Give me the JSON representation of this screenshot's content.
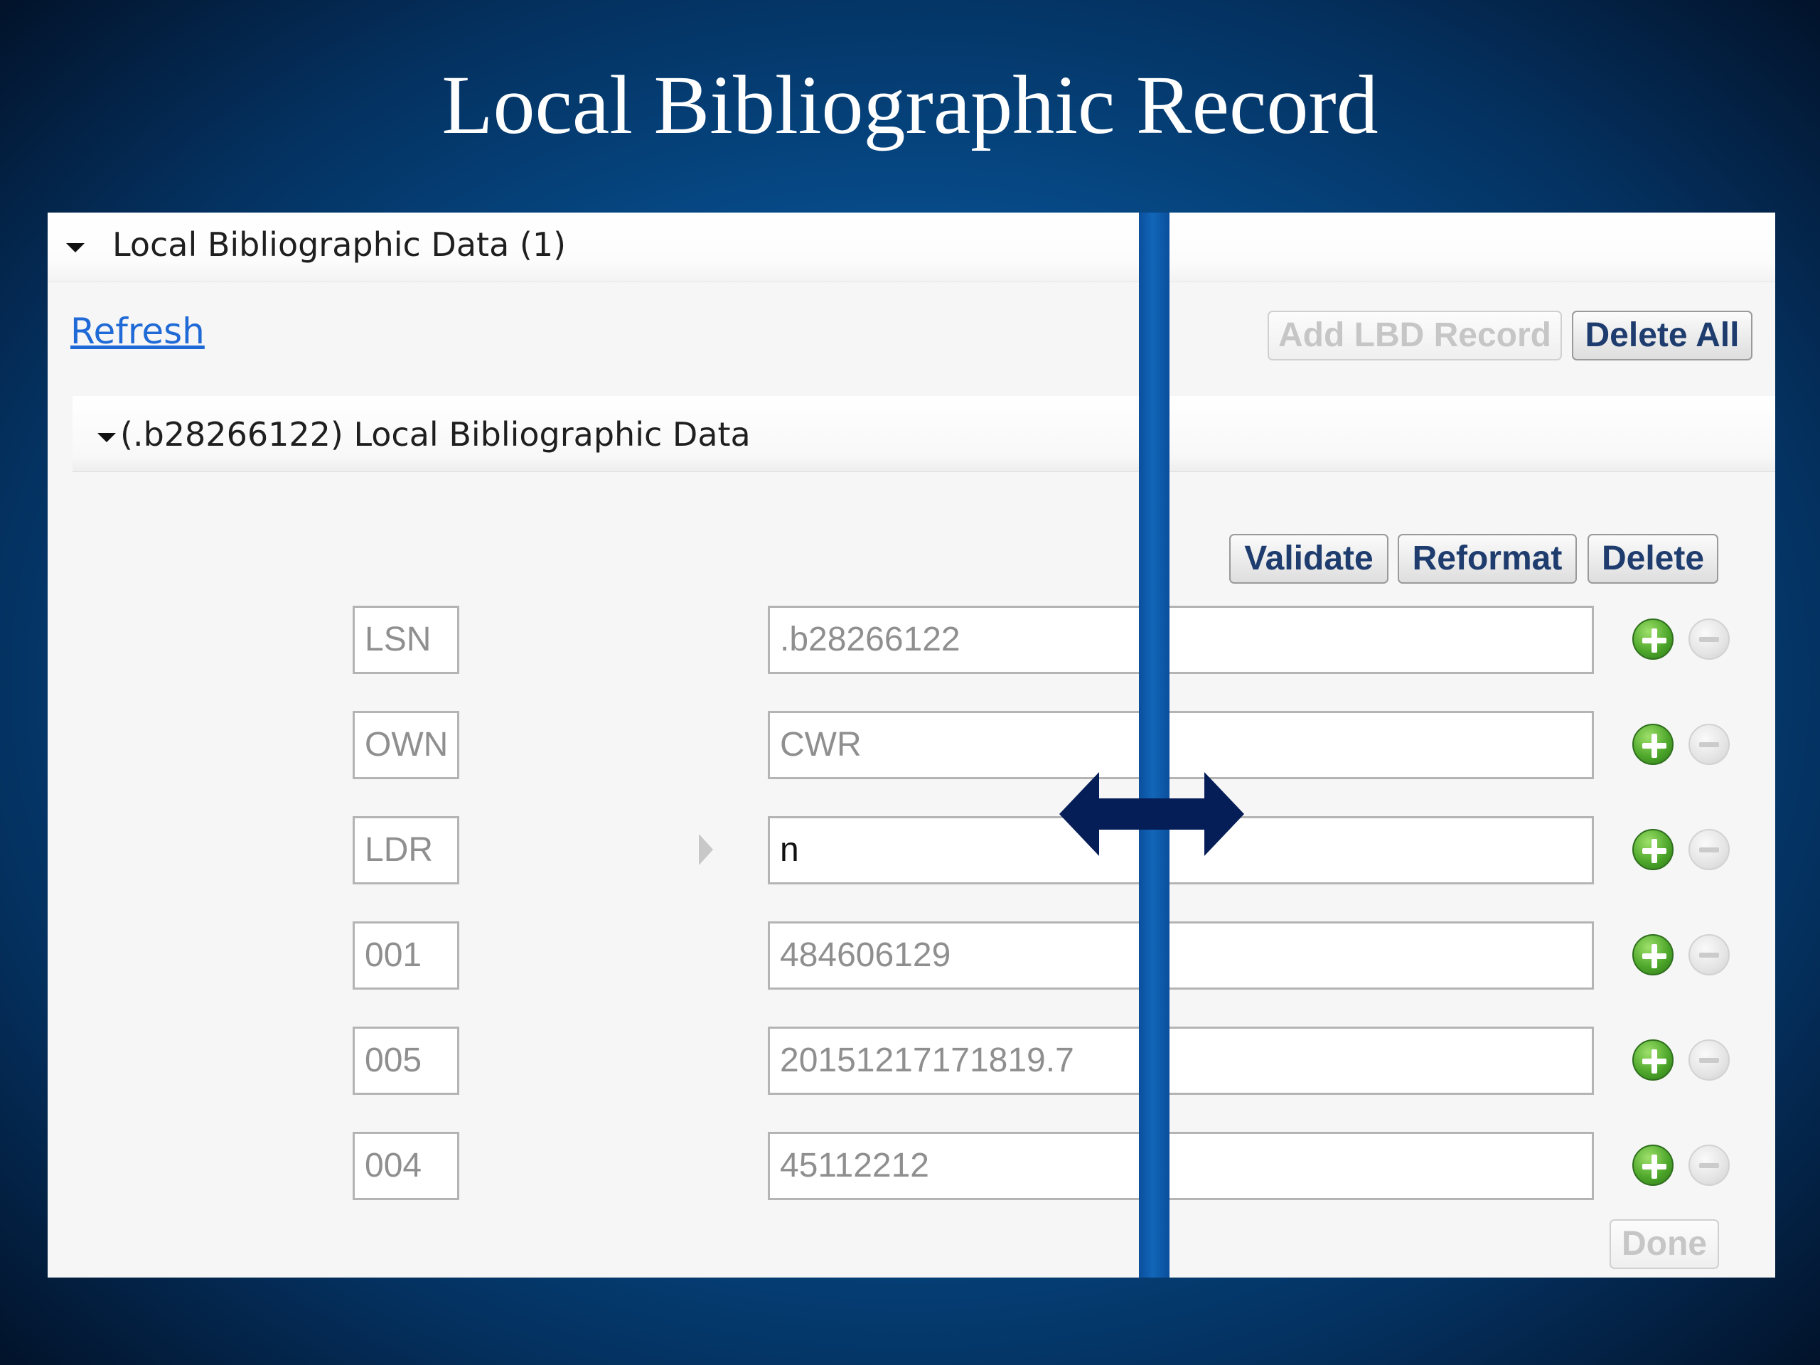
{
  "slide": {
    "title": "Local Bibliographic Record"
  },
  "section": {
    "title": "Local Bibliographic Data (1)",
    "refresh_label": "Refresh",
    "add_record_label": "Add LBD Record",
    "delete_all_label": "Delete All"
  },
  "record": {
    "title": "(.b28266122) Local Bibliographic Data",
    "validate_label": "Validate",
    "reformat_label": "Reformat",
    "delete_label": "Delete",
    "done_label": "Done",
    "fields": [
      {
        "tag": "LSN",
        "value": ".b28266122"
      },
      {
        "tag": "OWN",
        "value": "CWR"
      },
      {
        "tag": "LDR",
        "value": "n"
      },
      {
        "tag": "001",
        "value": "484606129"
      },
      {
        "tag": "005",
        "value": "20151217171819.7"
      },
      {
        "tag": "004",
        "value": "45112212"
      }
    ]
  },
  "icons": {
    "collapse": "caret-down-icon",
    "expand_row": "caret-right-icon",
    "add": "add-circle-icon",
    "remove": "remove-circle-icon",
    "resize": "double-arrow-icon"
  },
  "colors": {
    "link": "#1f6ad6",
    "button_text": "#1e3c6e",
    "add_icon": "#4fa82c",
    "divider": "#1266b8"
  }
}
